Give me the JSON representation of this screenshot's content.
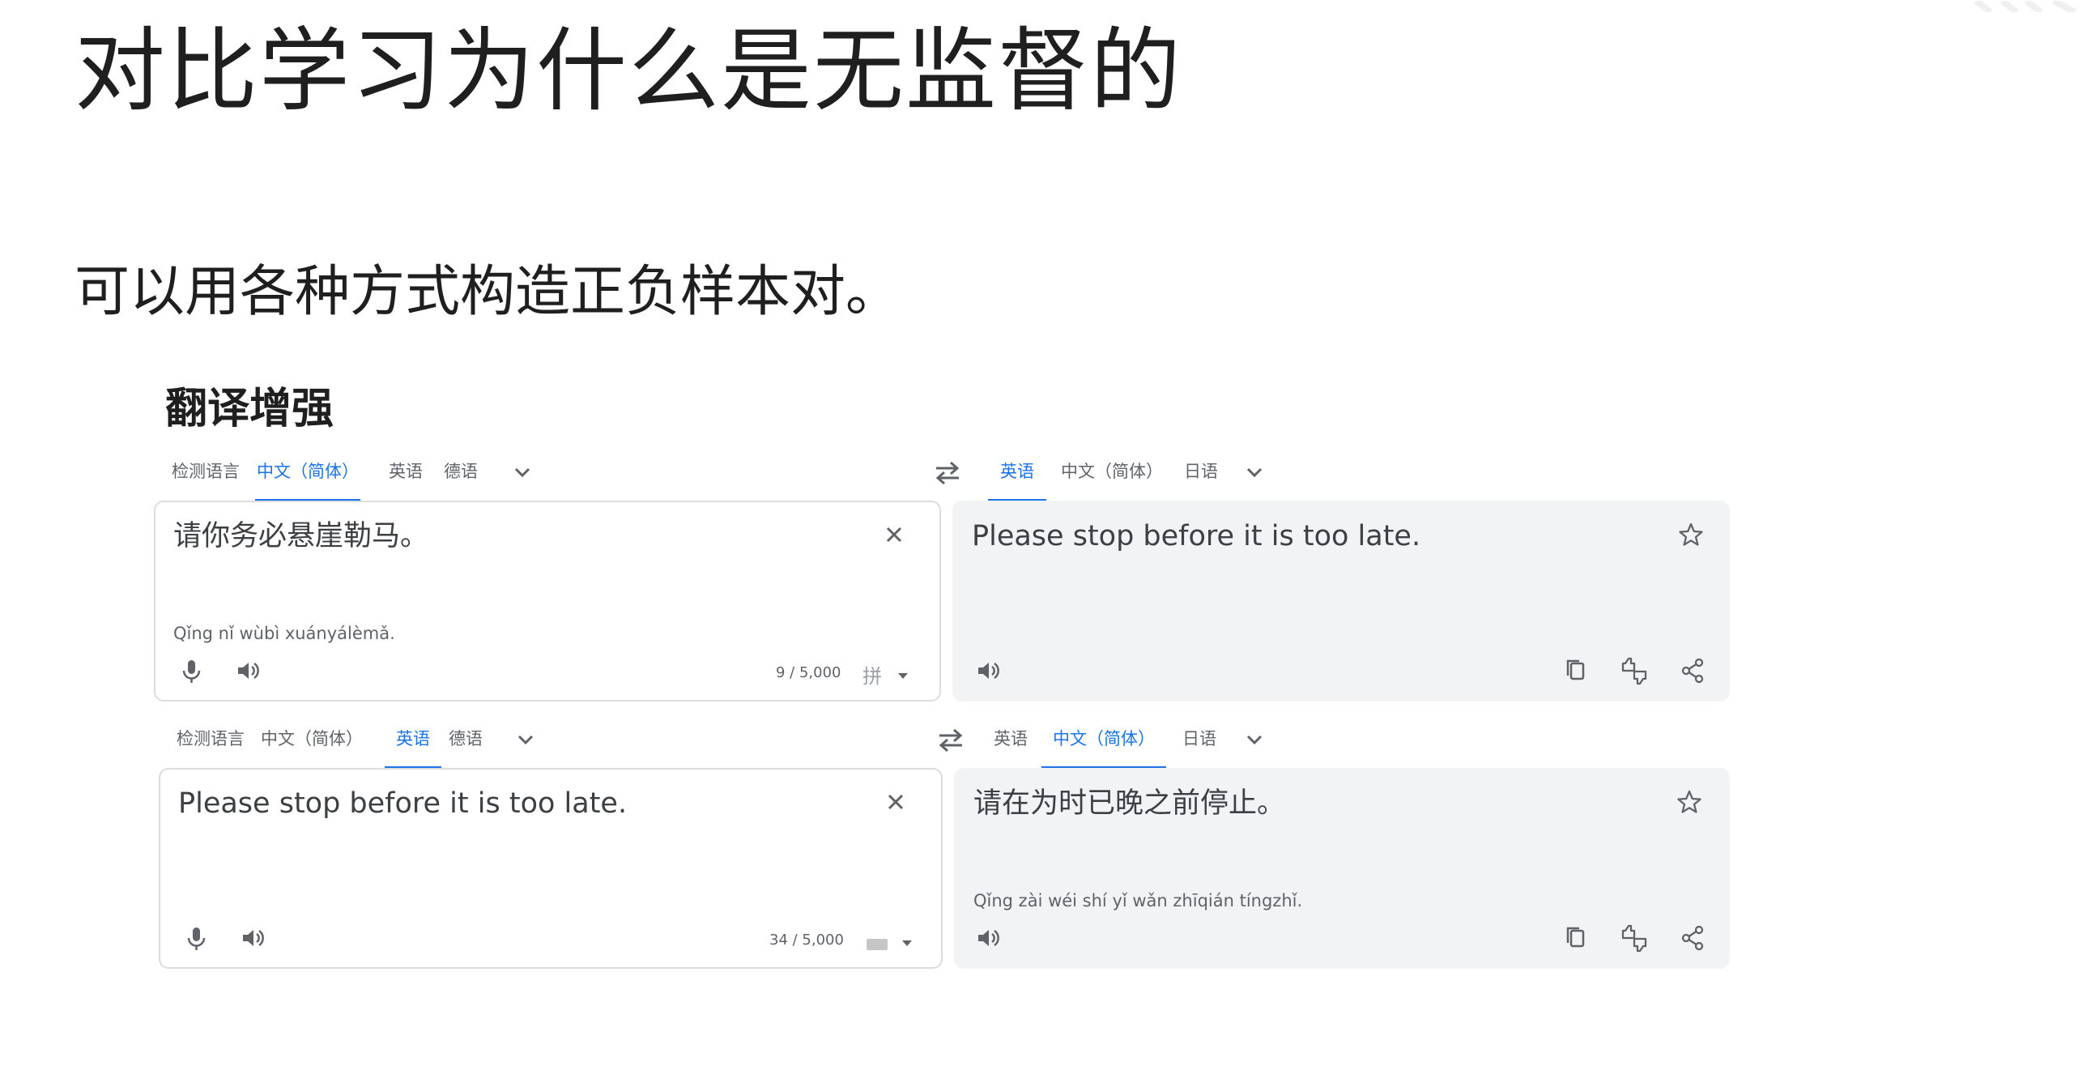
{
  "slide": {
    "title": "对比学习为什么是无监督的",
    "subtitle": "可以用各种方式构造正负样本对。",
    "section_label": "翻译增强"
  },
  "translators": [
    {
      "source_tabs": [
        "检测语言",
        "中文（简体）",
        "英语",
        "德语"
      ],
      "source_active": 1,
      "target_tabs": [
        "英语",
        "中文（简体）",
        "日语"
      ],
      "target_active": 0,
      "source_text": "请你务必悬崖勒马。",
      "source_romanization": "Qǐng nǐ wùbì xuányálèmǎ.",
      "char_count": "9 / 5,000",
      "input_method": "拼",
      "target_text": "Please stop before it is too late.",
      "target_romanization": ""
    },
    {
      "source_tabs": [
        "检测语言",
        "中文（简体）",
        "英语",
        "德语"
      ],
      "source_active": 2,
      "target_tabs": [
        "英语",
        "中文（简体）",
        "日语"
      ],
      "target_active": 1,
      "source_text": "Please stop before it is too late.",
      "source_romanization": "",
      "char_count": "34 / 5,000",
      "input_method": "keyboard-icon",
      "target_text": "请在为时已晚之前停止。",
      "target_romanization": "Qǐng zài wéi shí yǐ wǎn zhīqián tíngzhǐ."
    }
  ],
  "icons": {
    "more_languages": "chevron-down-icon",
    "swap": "swap-languages-icon",
    "clear": "close-icon",
    "voice_input": "microphone-icon",
    "listen": "speaker-icon",
    "save": "star-icon",
    "copy": "copy-icon",
    "rate": "thumbs-rating-icon",
    "share": "share-icon"
  },
  "colors": {
    "accent": "#1a73e8",
    "tab_text": "#5f6368",
    "output_background": "#f1f3f4",
    "input_border": "#dadce0",
    "body_text": "#3c4043"
  }
}
